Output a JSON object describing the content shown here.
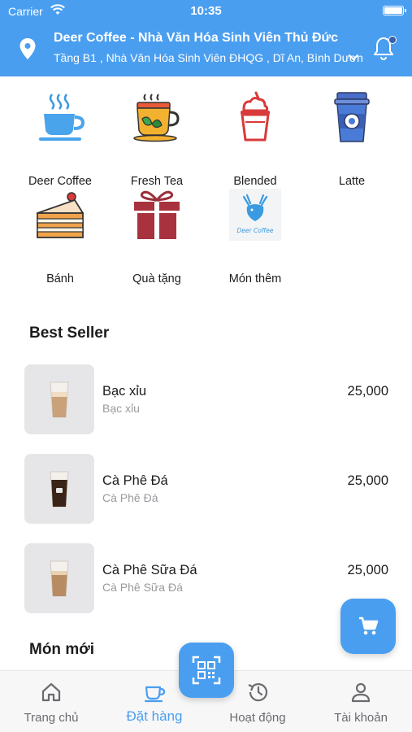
{
  "status_bar": {
    "carrier": "Carrier",
    "time": "10:35"
  },
  "header": {
    "store_name": "Deer Coffee - Nhà Văn Hóa Sinh Viên Thủ Đức",
    "store_address": "Tầng B1 , Nhà Văn Hóa Sinh Viên ĐHQG , Dĩ An, Bình Dương"
  },
  "categories": [
    {
      "label": "Deer Coffee",
      "icon": "coffee-cup-icon"
    },
    {
      "label": "Fresh Tea",
      "icon": "teapot-icon"
    },
    {
      "label": "Blended",
      "icon": "blended-drink-icon"
    },
    {
      "label": "Latte",
      "icon": "latte-cup-icon"
    },
    {
      "label": "Bánh",
      "icon": "cake-icon"
    },
    {
      "label": "Quà tặng",
      "icon": "gift-icon"
    },
    {
      "label": "Món thêm",
      "icon": "deer-coffee-logo-icon",
      "logo_text": "Deer Coffee"
    }
  ],
  "best_seller": {
    "title": "Best Seller",
    "items": [
      {
        "name": "Bạc xỉu",
        "subtitle": "Bạc xỉu",
        "price": "25,000",
        "drink_color": "#c9a27a"
      },
      {
        "name": "Cà Phê Đá",
        "subtitle": "Cà Phê Đá",
        "price": "25,000",
        "drink_color": "#3a2418"
      },
      {
        "name": "Cà Phê Sữa Đá",
        "subtitle": "Cà Phê Sữa Đá",
        "price": "25,000",
        "drink_color": "#b88c62"
      }
    ]
  },
  "new_items": {
    "title": "Món mới"
  },
  "bottom_nav": [
    {
      "label": "Trang chủ",
      "icon": "home-icon"
    },
    {
      "label": "Đặt hàng",
      "icon": "order-cup-icon",
      "active": true
    },
    {
      "label": "Hoạt động",
      "icon": "history-icon"
    },
    {
      "label": "Tài khoản",
      "icon": "account-icon"
    }
  ],
  "colors": {
    "primary": "#4a9ef0",
    "text": "#1c1c1e",
    "subtext": "#9a9a9e"
  }
}
